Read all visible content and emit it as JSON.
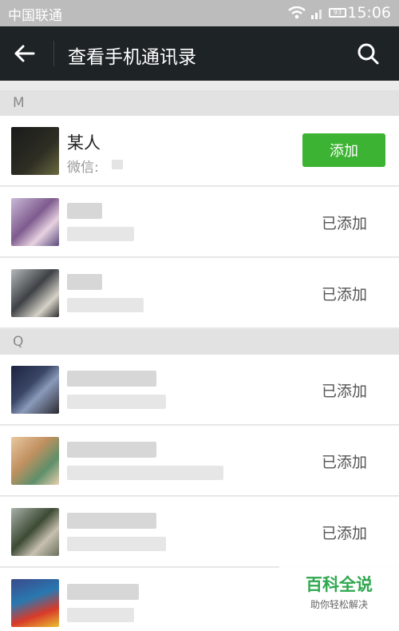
{
  "status_bar": {
    "carrier": "中国联通",
    "time": "15:06",
    "battery": "93"
  },
  "header": {
    "title": "查看手机通讯录"
  },
  "sections": [
    {
      "letter": "M"
    },
    {
      "letter": "Q"
    }
  ],
  "contacts": {
    "c0": {
      "name": "某人",
      "sub": "微信:",
      "action": "添加"
    },
    "c1": {
      "action": "已添加"
    },
    "c2": {
      "action": "已添加"
    },
    "c3": {
      "action": "已添加"
    },
    "c4": {
      "action": "已添加"
    },
    "c5": {
      "action": "已添加"
    }
  },
  "watermark": {
    "title": "百科全说",
    "subtitle": "助你轻松解决"
  },
  "colors": {
    "titlebar": "#1e2325",
    "accent_green": "#3cb332",
    "section_bg": "#e2e2e2"
  }
}
